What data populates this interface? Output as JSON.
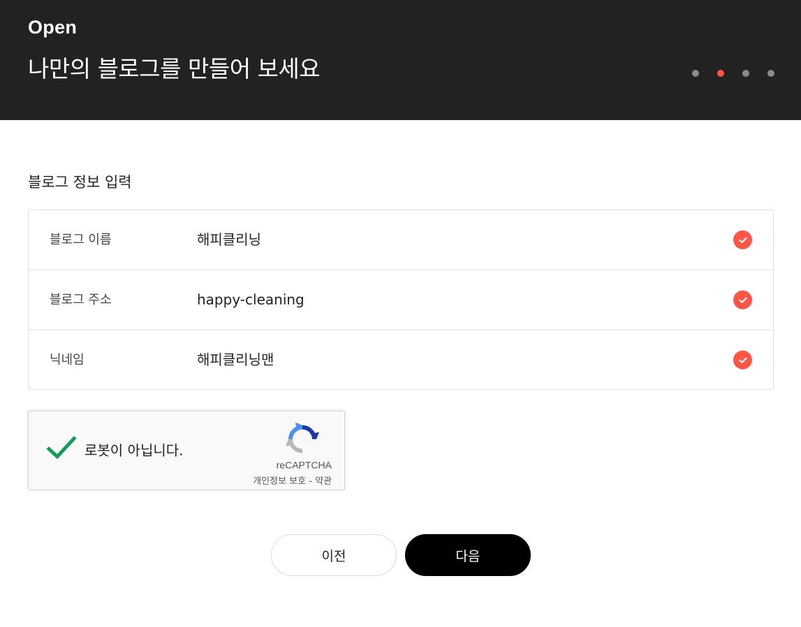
{
  "header": {
    "brand": "Open",
    "title": "나만의 블로그를 만들어 보세요",
    "steps": [
      {
        "active": false
      },
      {
        "active": true
      },
      {
        "active": false
      },
      {
        "active": false
      }
    ]
  },
  "section": {
    "title": "블로그 정보 입력"
  },
  "info": {
    "rows": [
      {
        "label": "블로그 이름",
        "value": "해피클리닝",
        "icon": "check-circle-icon"
      },
      {
        "label": "블로그 주소",
        "value": "happy-cleaning",
        "icon": "check-circle-icon"
      },
      {
        "label": "닉네임",
        "value": "해피클리닝맨",
        "icon": "check-circle-icon"
      }
    ]
  },
  "captcha": {
    "label": "로봇이 아닙니다.",
    "brand": "reCAPTCHA",
    "privacy": "개인정보 보호",
    "separator": " - ",
    "terms": "약관"
  },
  "buttons": {
    "prev_label": "이전",
    "next_label": "다음"
  },
  "colors": {
    "header_bg": "#222222",
    "accent": "#ff5544",
    "captcha_check": "#0f9d58",
    "primary_button": "#000000"
  }
}
